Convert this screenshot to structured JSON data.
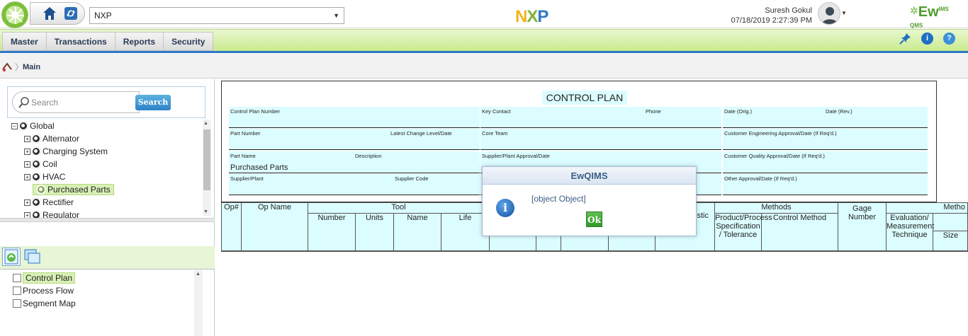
{
  "topbar": {
    "company_select": "NXP",
    "user_name": "Suresh Gokul",
    "datetime": "07/18/2019 2:27:39 PM",
    "brand": "EwQIMS",
    "brand_sup": "IMS",
    "brand_main": "Ew",
    "brand_sub": "QMS"
  },
  "menu": {
    "items": [
      "Master",
      "Transactions",
      "Reports",
      "Security"
    ]
  },
  "breadcrumb": {
    "main": "Main"
  },
  "search": {
    "placeholder": "Search",
    "button": "Search"
  },
  "tree": {
    "root": "Global",
    "children": [
      "Alternator",
      "Charging System",
      "Coil",
      "HVAC",
      "Purchased Parts",
      "Rectifier",
      "Regulator"
    ]
  },
  "doc_list": [
    "Control Plan",
    "Process Flow",
    "Segment Map"
  ],
  "plan": {
    "title": "CONTROL PLAN",
    "control_plan_number": "Control Plan Number",
    "key_contact": "Key Contact",
    "phone": "Phone",
    "date_orig": "Date (Orig.)",
    "date_rev": "Date (Rev.)",
    "part_number": "Part Number",
    "latest_change": "Latest Change Level/Date",
    "core_team": "Core Team",
    "cust_eng_approval": "Customer Engineering Approval/Date (If Req'd.)",
    "part_name": "Part Name",
    "description": "Description",
    "part_name_value": "Purchased Parts",
    "supplier_plant_approval": "Supplier/Plant Approval/Date",
    "cust_quality_approval": "Customer Quality Approval/Date (If Req'd.)",
    "supplier_plant": "Supplier/Plant",
    "supplier_code": "Supplier Code",
    "other_approval": "Other Approval/Date (If Req'd.)"
  },
  "grid": {
    "op_no": "Op#",
    "op_name": "Op Name",
    "tool": "Tool",
    "number": "Number",
    "units": "Units",
    "name": "Name",
    "life": "Life",
    "characteristic_fragment": "stic",
    "methods": "Methods",
    "product_spec": "Product/Process Specification / Tolerance",
    "control_method": "Control Method",
    "gage_number": "Gage Number",
    "methods2": "Metho",
    "evaluation": "Evaluation/ Measurement Technique",
    "size": "Size"
  },
  "dialog": {
    "title": "EwQIMS",
    "message": "[object Object]",
    "ok": "Ok"
  },
  "colors": {
    "menu_green": "#c8ea8c",
    "accent_blue": "#2d78c5",
    "cyan_field": "#dcfdff",
    "highlight": "#d9f0b6"
  }
}
